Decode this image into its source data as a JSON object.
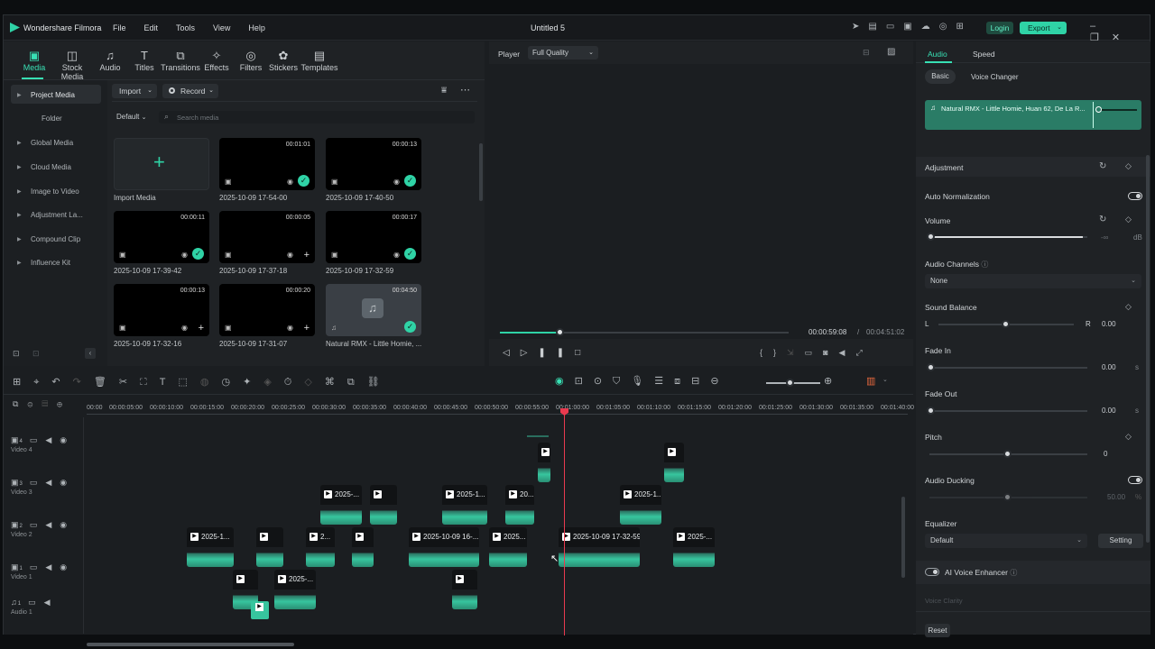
{
  "app": {
    "name": "Wondershare Filmora",
    "title": "Untitled 5",
    "login": "Login",
    "export": "Export"
  },
  "menu": [
    "File",
    "Edit",
    "Tools",
    "View",
    "Help"
  ],
  "tools": [
    {
      "label": "Media",
      "icon": "media-icon",
      "active": true
    },
    {
      "label": "Stock Media",
      "icon": "stock-media-icon"
    },
    {
      "label": "Audio",
      "icon": "audio-icon"
    },
    {
      "label": "Titles",
      "icon": "titles-icon"
    },
    {
      "label": "Transitions",
      "icon": "transitions-icon"
    },
    {
      "label": "Effects",
      "icon": "effects-icon"
    },
    {
      "label": "Filters",
      "icon": "filters-icon"
    },
    {
      "label": "Stickers",
      "icon": "stickers-icon"
    },
    {
      "label": "Templates",
      "icon": "templates-icon"
    }
  ],
  "sidebar": {
    "items": [
      "Project Media",
      "Folder",
      "Global Media",
      "Cloud Media",
      "Image to Video",
      "Adjustment La...",
      "Compound Clip",
      "Influence Kit"
    ]
  },
  "media": {
    "import": "Import",
    "record": "Record",
    "sort": "Default",
    "search_placeholder": "Search media",
    "import_media": "Import Media",
    "items": [
      {
        "name": "2025-10-09 17-54-00",
        "duration": "00:01:01",
        "status": "check"
      },
      {
        "name": "2025-10-09 17-40-50",
        "duration": "00:00:13",
        "status": "check"
      },
      {
        "name": "2025-10-09 17-39-42",
        "duration": "00:00:11",
        "status": "check"
      },
      {
        "name": "2025-10-09 17-37-18",
        "duration": "00:00:05",
        "status": "plus"
      },
      {
        "name": "2025-10-09 17-32-59",
        "duration": "00:00:17",
        "status": "check"
      },
      {
        "name": "2025-10-09 17-32-16",
        "duration": "00:00:13",
        "status": "plus"
      },
      {
        "name": "2025-10-09 17-31-07",
        "duration": "00:00:20",
        "status": "plus"
      },
      {
        "name": "Natural RMX - Little Homie, ...",
        "duration": "00:04:50",
        "status": "check"
      }
    ]
  },
  "player": {
    "label": "Player",
    "quality": "Full Quality",
    "current": "00:00:59:08",
    "separator": "/",
    "total": "00:04:51:02",
    "progress": 0.12
  },
  "timeline": {
    "ruler": [
      "00:00",
      "00:00:05:00",
      "00:00:10:00",
      "00:00:15:00",
      "00:00:20:00",
      "00:00:25:00",
      "00:00:30:00",
      "00:00:35:00",
      "00:00:40:00",
      "00:00:45:00",
      "00:00:50:00",
      "00:00:55:00",
      "00:01:00:00",
      "00:01:05:00",
      "00:01:10:00",
      "00:01:15:00",
      "00:01:20:00",
      "00:01:25:00",
      "00:01:30:00",
      "00:01:35:00",
      "00:01:40:00"
    ],
    "tracks": [
      {
        "num": "4",
        "name": "Video 4"
      },
      {
        "num": "3",
        "name": "Video 3"
      },
      {
        "num": "2",
        "name": "Video 2"
      },
      {
        "num": "1",
        "name": "Video 1"
      },
      {
        "num": "1",
        "name": "Audio 1"
      }
    ],
    "clip_labels": {
      "c1": "2025-...",
      "c2": "2025-1...",
      "c3": "20...",
      "c4": "2025-1...",
      "c5": "2025-1...",
      "c6": "2...",
      "c7": "2025-10-09 16-...",
      "c8": "2025...",
      "c9": "2025-10-09 17-32-59",
      "c10": "2025-...",
      "c11": "2025-..."
    }
  },
  "right": {
    "tabs": [
      "Audio",
      "Speed"
    ],
    "subtabs": [
      "Basic",
      "Voice Changer"
    ],
    "clip": "Natural RMX - Little Homie, Huan 62, De La R...",
    "adjustment": "Adjustment",
    "auto_norm": "Auto Normalization",
    "volume": "Volume",
    "volume_val": "-∞",
    "volume_unit": "dB",
    "volume_level": 0.97,
    "channels": "Audio Channels",
    "channels_val": "None",
    "balance": "Sound Balance",
    "bal_l": "L",
    "bal_r": "R",
    "balance_val": "0.00",
    "fade_in": "Fade In",
    "fade_in_val": "0.00",
    "fade_out": "Fade Out",
    "fade_out_val": "0.00",
    "sec": "s",
    "pitch": "Pitch",
    "pitch_val": "0",
    "ducking": "Audio Ducking",
    "ducking_val": "50.00",
    "pct": "%",
    "eq": "Equalizer",
    "eq_val": "Default",
    "setting": "Setting",
    "enhancer": "AI Voice Enhancer",
    "clarity": "Voice Clarity",
    "reset": "Reset"
  }
}
